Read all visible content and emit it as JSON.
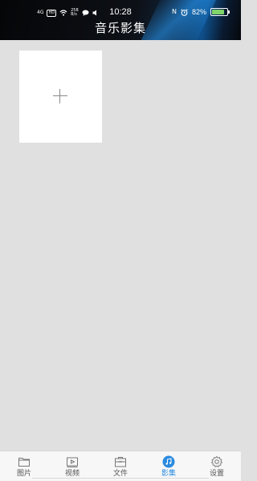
{
  "status_bar": {
    "network": "4G",
    "hd": "HD",
    "speed_value": "258",
    "speed_unit": "B/s",
    "time": "10:28",
    "nfc": "N",
    "battery_percent": "82%",
    "battery_level": 0.82
  },
  "header": {
    "title": "音乐影集"
  },
  "colors": {
    "accent": "#2a8be0",
    "background": "#e0e0e0",
    "header_dark": "#0d1016"
  },
  "tabs": [
    {
      "label": "图片",
      "icon": "folder-icon",
      "active": false
    },
    {
      "label": "视频",
      "icon": "video-icon",
      "active": false
    },
    {
      "label": "文件",
      "icon": "file-box-icon",
      "active": false
    },
    {
      "label": "影集",
      "icon": "music-note-icon",
      "active": true
    },
    {
      "label": "设置",
      "icon": "gear-icon",
      "active": false
    }
  ]
}
